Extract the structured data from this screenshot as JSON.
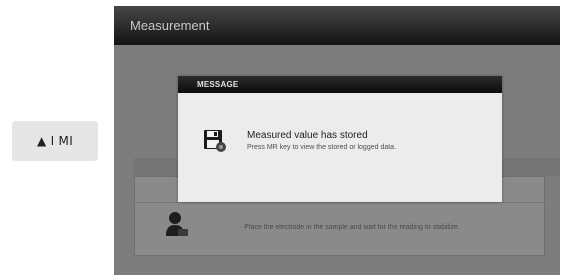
{
  "side_button": {
    "label": "▲ I MI"
  },
  "window": {
    "title": "Measurement"
  },
  "background_panel": {
    "instruction": "· Place the electrode in the sample and wait for the reading to stabilize."
  },
  "dialog": {
    "title": "MESSAGE",
    "message": "Measured value has stored",
    "detail": "Press MR key to view the stored or logged data."
  },
  "icons": [
    "floppy-disk-icon",
    "person-icon"
  ]
}
